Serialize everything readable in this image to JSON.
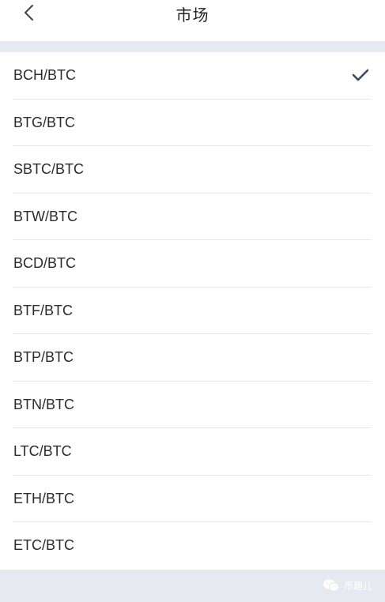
{
  "header": {
    "title": "市场",
    "back_icon": "chevron-left-icon"
  },
  "markets": {
    "selected_index": 0,
    "check_icon": "checkmark-icon",
    "accent_color": "#3a4a6b",
    "items": [
      {
        "label": "BCH/BTC",
        "selected": true
      },
      {
        "label": "BTG/BTC",
        "selected": false
      },
      {
        "label": "SBTC/BTC",
        "selected": false
      },
      {
        "label": "BTW/BTC",
        "selected": false
      },
      {
        "label": "BCD/BTC",
        "selected": false
      },
      {
        "label": "BTF/BTC",
        "selected": false
      },
      {
        "label": "BTP/BTC",
        "selected": false
      },
      {
        "label": "BTN/BTC",
        "selected": false
      },
      {
        "label": "LTC/BTC",
        "selected": false
      },
      {
        "label": "ETH/BTC",
        "selected": false
      },
      {
        "label": "ETC/BTC",
        "selected": false
      }
    ]
  },
  "watermark": {
    "text": "币趣儿",
    "icon": "wechat-icon"
  }
}
